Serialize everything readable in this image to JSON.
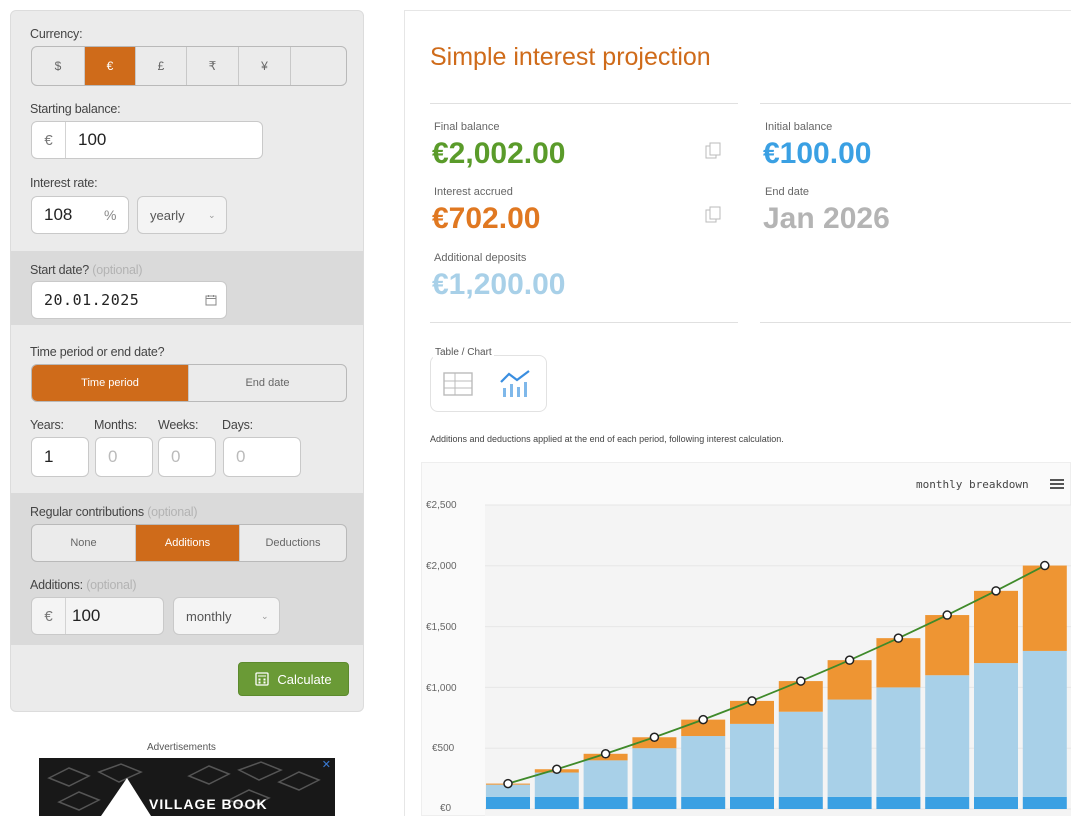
{
  "form": {
    "currency_label": "Currency:",
    "currencies": [
      "$",
      "€",
      "£",
      "₹",
      "¥",
      ""
    ],
    "starting_balance_label": "Starting balance:",
    "currency_symbol": "€",
    "starting_balance": "100",
    "interest_rate_label": "Interest rate:",
    "interest_rate": "108",
    "percent_sign": "%",
    "rate_period": "yearly",
    "start_date_label": "Start date?",
    "optional": "(optional)",
    "start_date": "20.01.2025",
    "period_label": "Time period or end date?",
    "period_tabs": [
      "Time period",
      "End date"
    ],
    "years_label": "Years:",
    "months_label": "Months:",
    "weeks_label": "Weeks:",
    "days_label": "Days:",
    "years": "1",
    "months": "0",
    "weeks": "0",
    "days": "0",
    "contrib_label": "Regular contributions",
    "contrib_tabs": [
      "None",
      "Additions",
      "Deductions"
    ],
    "additions_label": "Additions:",
    "additions": "100",
    "additions_period": "monthly",
    "calculate": "Calculate"
  },
  "ads": {
    "label": "Advertisements",
    "text": "VILLAGE BOOK",
    "close": "✕"
  },
  "results": {
    "title": "Simple interest projection",
    "final_balance_label": "Final balance",
    "final_balance": "€2,002.00",
    "initial_balance_label": "Initial balance",
    "initial_balance": "€100.00",
    "interest_label": "Interest accrued",
    "interest": "€702.00",
    "end_date_label": "End date",
    "end_date": "Jan 2026",
    "deposits_label": "Additional deposits",
    "deposits": "€1,200.00",
    "toggle_label": "Table / Chart",
    "note": "Additions and deductions applied at the end of each period, following interest calculation.",
    "breakdown": "monthly breakdown"
  },
  "colors": {
    "accent": "#cf6b1a",
    "green": "#5a9b2a",
    "blue": "#3aa0e3",
    "light_blue": "#a8d0e8",
    "grey": "#b4b4b4"
  },
  "chart_data": {
    "type": "bar",
    "stacked": true,
    "y_ticks": [
      "€2,500",
      "€2,000",
      "€1,500",
      "€1,000",
      "€500",
      "€0"
    ],
    "ylim": [
      0,
      2500
    ],
    "periods": 12,
    "series": [
      {
        "values": [
          100,
          100,
          100,
          100,
          100,
          100,
          100,
          100,
          100,
          100,
          100,
          100
        ]
      },
      {
        "values": [
          100,
          200,
          300,
          400,
          500,
          600,
          700,
          800,
          900,
          1000,
          1100,
          1200
        ]
      },
      {
        "values": [
          9,
          27,
          54,
          90,
          135,
          189,
          252,
          324,
          405,
          495,
          594,
          702
        ]
      }
    ],
    "line": [
      209,
      327,
      454,
      590,
      735,
      889,
      1052,
      1224,
      1405,
      1595,
      1794,
      2002
    ]
  }
}
